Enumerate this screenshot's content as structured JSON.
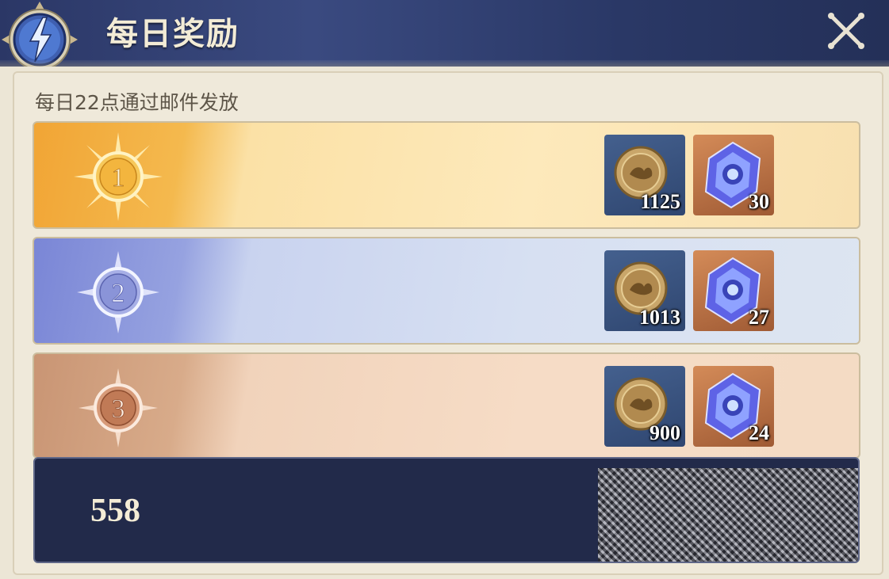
{
  "header": {
    "title": "每日奖励"
  },
  "subtitle": "每日22点通过邮件发放",
  "ranks": [
    {
      "rank": "1",
      "tier": "gold",
      "coin_qty": "1125",
      "gem_qty": "30"
    },
    {
      "rank": "2",
      "tier": "silver",
      "coin_qty": "1013",
      "gem_qty": "27"
    },
    {
      "rank": "3",
      "tier": "bronze",
      "coin_qty": "900",
      "gem_qty": "24"
    }
  ],
  "self_row": {
    "rank": "558"
  },
  "icons": {
    "emblem": "lightning-emblem-icon",
    "close": "close-icon",
    "coin": "coin-icon",
    "gem": "gem-icon"
  },
  "colors": {
    "header_bg": "#2b3766",
    "gold": "#f1a535",
    "silver": "#7a86d6",
    "bronze": "#c99574",
    "self_row_bg": "#222a4a"
  }
}
